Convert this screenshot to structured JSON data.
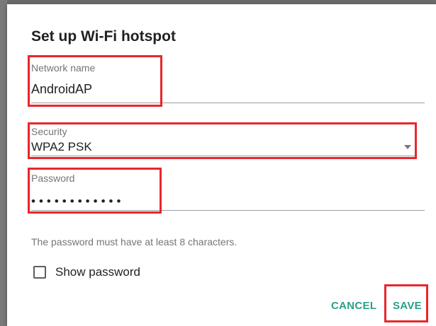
{
  "dialog": {
    "title": "Set up Wi-Fi hotspot"
  },
  "network_name": {
    "label": "Network name",
    "value": "AndroidAP"
  },
  "security": {
    "label": "Security",
    "value": "WPA2 PSK"
  },
  "password": {
    "label": "Password",
    "masked_value": "••••••••••••",
    "hint": "The password must have at least 8 characters."
  },
  "show_password": {
    "label": "Show password",
    "checked": false
  },
  "actions": {
    "cancel_label": "CANCEL",
    "save_label": "SAVE"
  },
  "colors": {
    "accent": "#28a08a",
    "highlight_box": "#e8262d",
    "scrim": "#6f6f6f"
  }
}
